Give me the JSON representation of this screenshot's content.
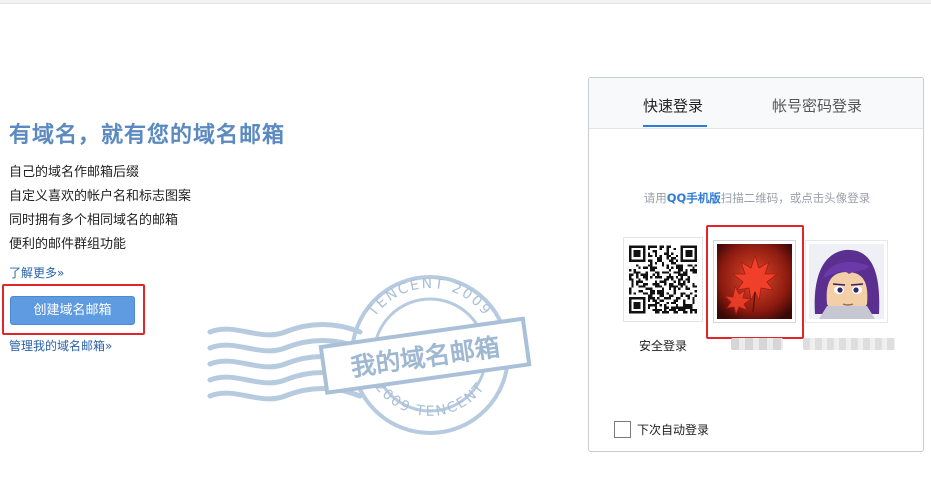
{
  "promo": {
    "title": "有域名，就有您的域名邮箱",
    "features": [
      "自己的域名作邮箱后缀",
      "自定义喜欢的帐户名和标志图案",
      "同时拥有多个相同域名的邮箱",
      "便利的邮件群组功能"
    ],
    "learn_more": "了解更多»",
    "create_button": "创建域名邮箱",
    "manage_link": "管理我的域名邮箱»"
  },
  "stamp": {
    "center_text": "我的域名邮箱",
    "ring_top": "TENCENT 2009",
    "ring_bottom": "2009 TENCENT"
  },
  "login": {
    "tabs": [
      "快速登录",
      "帐号密码登录"
    ],
    "active_tab": "快速登录",
    "hint_prefix": "请用",
    "hint_highlight": "QQ手机版",
    "hint_suffix": "扫描二维码，或点击头像登录",
    "qr_label": "安全登录",
    "auto_login": "下次自动登录"
  },
  "colors": {
    "accent": "#2f7bd8",
    "title_blue": "#5b8ac0",
    "button_blue": "#5f9be0",
    "highlight_red": "#e0262b",
    "stamp_blue": "#a9c0d8"
  }
}
